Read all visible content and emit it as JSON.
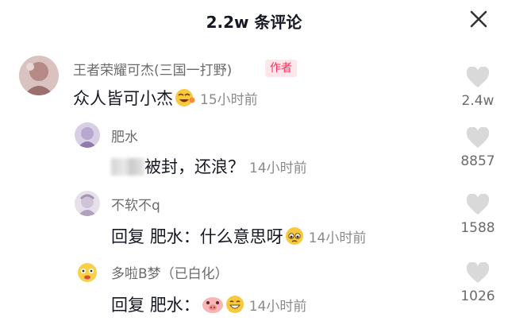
{
  "header": {
    "title": "2.2w 条评论",
    "close_icon": "close-icon"
  },
  "comments": [
    {
      "author": "王者荣耀可杰(三国一打野)",
      "badge": "作者",
      "text": "众人皆可小杰",
      "emojis": [
        "laughing-face-emoji"
      ],
      "time": "15小时前",
      "likes": "2.4w"
    },
    {
      "author": "肥水",
      "text": "被封，还浪？",
      "time": "14小时前",
      "likes": "8857"
    },
    {
      "author": "不软不q",
      "reply_prefix": "回复",
      "reply_to": "肥水",
      "text": "：什么意思呀",
      "emojis": [
        "worried-face-emoji"
      ],
      "time": "14小时前",
      "likes": "1588"
    },
    {
      "author": "多啦B梦（已白化）",
      "reply_prefix": "回复",
      "reply_to": "肥水",
      "text": "：",
      "emojis": [
        "pig-face-emoji",
        "grinning-face-emoji"
      ],
      "time": "14小时前",
      "likes": "1026"
    }
  ],
  "colors": {
    "badge": "#fe2c55",
    "badge_bg": "#ffe6eb",
    "heart": "#d9d9d9",
    "meta": "#8a8a8a"
  }
}
